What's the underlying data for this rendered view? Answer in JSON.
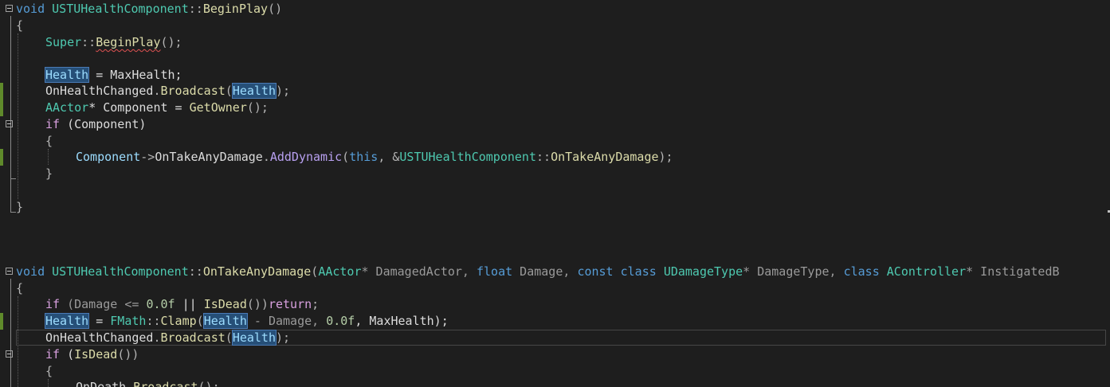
{
  "editor": {
    "fn1": {
      "ret": "void",
      "cls": "USTUHealthComponent",
      "sep": "::",
      "name": "BeginPlay",
      "params": "()",
      "open": "{",
      "super": "Super",
      "super_sep": "::",
      "super_call": "BeginPlay",
      "super_tail": "();",
      "health": "Health",
      "assign": " = MaxHealth;",
      "event1": "OnHealthChanged",
      "dot": ".",
      "broadcast": "Broadcast",
      "paren_open": "(",
      "paren_close_semi": ");",
      "actor_type": "AActor",
      "ptr_decl": "* Component = ",
      "get_owner": "GetOwner",
      "get_owner_tail": "();",
      "if_kw": "if",
      "if_cond": " (Component)",
      "inner_open": "{",
      "comp": "Component",
      "arrow": "->",
      "take_any": "OnTakeAnyDamage",
      "add_dyn": "AddDynamic",
      "this_kw": "this",
      "amp": ", &",
      "cls2": "USTUHealthComponent",
      "sep2": "::",
      "take_any2": "OnTakeAnyDamage",
      "end_call": ");",
      "inner_close": "}",
      "close": "}"
    },
    "fn2": {
      "ret": "void",
      "cls": "USTUHealthComponent",
      "sep": "::",
      "name": "OnTakeAnyDamage",
      "p_open": "(",
      "p_actor": "AActor",
      "p_actor_name": "* DamagedActor, ",
      "p_float": "float",
      "p_damage": " Damage, ",
      "p_const": "const",
      "p_class": "class",
      "p_udt": "UDamageType",
      "p_udt_name": "* DamageType, ",
      "p_class2": "class",
      "p_actrl": "AController",
      "p_inst": "* InstigatedB",
      "open": "{",
      "if_kw": "if",
      "cond_a": " (Damage <= ",
      "zero": "0.0f",
      "or": " || ",
      "isdead": "IsDead",
      "cond_tail": "())",
      "ret_kw": "return",
      "semi": ";",
      "health": "Health",
      "eq": " = ",
      "fmath": "FMath",
      "csep": "::",
      "clamp": "Clamp",
      "cl_open": "(",
      "minus": " - Damage, ",
      "zero2": "0.0f",
      "maxh": ", MaxHealth);",
      "event": "OnHealthChanged",
      "dot": ".",
      "broadcast": "Broadcast",
      "bc_open": "(",
      "bc_close": ");",
      "if2_kw": "if",
      "if2_a": " (",
      "isdead2": "IsDead",
      "if2_b": "())",
      "inner_open": "{",
      "ondeath": "OnDeath",
      "dot2": ".",
      "bcast2": "Broadcast",
      "bc2_tail": "();"
    }
  }
}
